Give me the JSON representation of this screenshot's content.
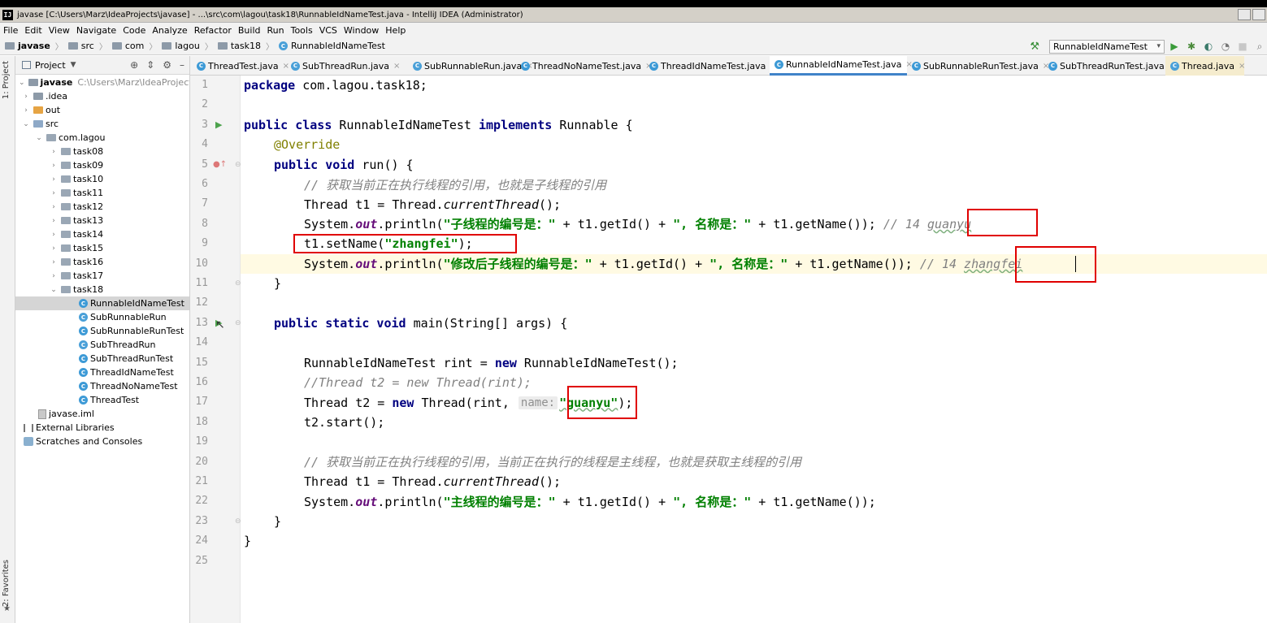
{
  "window": {
    "title": "javase [C:\\Users\\Marz\\IdeaProjects\\javase] - ...\\src\\com\\lagou\\task18\\RunnableIdNameTest.java - IntelliJ IDEA (Administrator)"
  },
  "menu": [
    "File",
    "Edit",
    "View",
    "Navigate",
    "Code",
    "Analyze",
    "Refactor",
    "Build",
    "Run",
    "Tools",
    "VCS",
    "Window",
    "Help"
  ],
  "breadcrumb": [
    "javase",
    "src",
    "com",
    "lagou",
    "task18",
    "RunnableIdNameTest"
  ],
  "run_config": "RunnableIdNameTest",
  "side_labels": {
    "project": "1: Project",
    "favorites": "2: Favorites"
  },
  "project_panel": {
    "title": "Project",
    "root_name": "javase",
    "root_path": "C:\\Users\\Marz\\IdeaProjects\\javase",
    "items": [
      ".idea",
      "out",
      "src",
      "com.lagou",
      "task08",
      "task09",
      "task10",
      "task11",
      "task12",
      "task13",
      "task14",
      "task15",
      "task16",
      "task17",
      "task18",
      "RunnableIdNameTest",
      "SubRunnableRun",
      "SubRunnableRunTest",
      "SubThreadRun",
      "SubThreadRunTest",
      "ThreadIdNameTest",
      "ThreadNoNameTest",
      "ThreadTest",
      "javase.iml",
      "External Libraries",
      "Scratches and Consoles"
    ]
  },
  "tabs": [
    "ThreadTest.java",
    "SubThreadRun.java",
    "SubRunnableRun.java",
    "ThreadNoNameTest.java",
    "ThreadIdNameTest.java",
    "RunnableIdNameTest.java",
    "SubRunnableRunTest.java",
    "SubThreadRunTest.java",
    "Thread.java"
  ],
  "active_tab_index": 5,
  "code": {
    "l1_kw": "package",
    "l1_rest": " com.lagou.task18;",
    "l3_kw1": "public class",
    "l3_name": " RunnableIdNameTest ",
    "l3_kw2": "implements",
    "l3_rest": " Runnable {",
    "l4": "@Override",
    "l5_kw": "public void",
    "l5_rest": " run() {",
    "l6": "// 获取当前正在执行线程的引用，也就是子线程的引用",
    "l7_a": "Thread t1 = Thread.",
    "l7_b": "currentThread",
    "l7_c": "();",
    "sys": "System.",
    "out": "out",
    "println": ".println(",
    "l8_s1": "\"子线程的编号是：\"",
    "plus_getid": " + t1.getId() + ",
    "l8_s2": "\", 名称是：\"",
    "plus_getname": " + t1.getName()); ",
    "cmt14": "// 14 ",
    "l8_cmt_name": "guanyu",
    "l9_a": "t1.setName(",
    "l9_s": "\"zhangfei\"",
    "l9_b": ");",
    "l10_s1": "\"修改后子线程的编号是：\"",
    "l10_s2": "\", 名称是：\"",
    "l10_cmt_name": "zhangfei",
    "brace": "}",
    "l13_kw": "public static void",
    "l13_rest": " main(String[] args) {",
    "l15_a": "RunnableIdNameTest rint = ",
    "new": "new",
    "l15_b": " RunnableIdNameTest();",
    "l16": "//Thread t2 = new Thread(rint);",
    "l17_a": "Thread t2 = ",
    "l17_b": " Thread(rint, ",
    "l17_hint": "name:",
    "l17_s": "\"guanyu\"",
    "l17_c": ");",
    "l18": "t2.start();",
    "l20": "// 获取当前正在执行线程的引用，当前正在执行的线程是主线程，也就是获取主线程的引用",
    "l22_s1": "\"主线程的编号是：\"",
    "l22_s2": "\", 名称是：\"",
    "l22_end": " + t1.getName());"
  },
  "line_numbers": [
    "1",
    "2",
    "3",
    "4",
    "5",
    "6",
    "7",
    "8",
    "9",
    "10",
    "11",
    "12",
    "13",
    "14",
    "15",
    "16",
    "17",
    "18",
    "19",
    "20",
    "21",
    "22",
    "23",
    "24",
    "25"
  ],
  "colors": {
    "keyword": "#000080",
    "string": "#008000",
    "comment": "#808080",
    "annotation": "#808000",
    "field": "#660e7a",
    "highlight_box": "#e00000",
    "current_line": "#fffae3"
  }
}
